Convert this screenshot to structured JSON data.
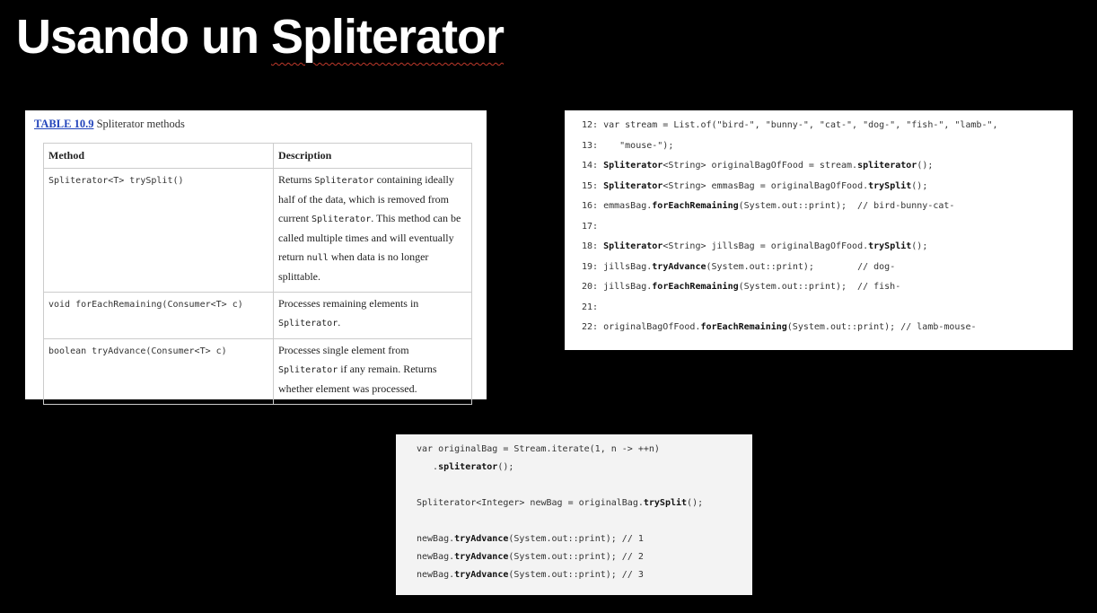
{
  "slide": {
    "title_pre": "Usando un ",
    "title_word": "Spliterator"
  },
  "table": {
    "caption_num": "TABLE 10.9",
    "caption_text": " Spliterator methods",
    "headers": [
      "Method",
      "Description"
    ],
    "rows": [
      {
        "method": "Spliterator<T> trySplit()",
        "desc_parts": [
          [
            "Returns ",
            false
          ],
          [
            "Spliterator",
            true
          ],
          [
            " containing ideally half of the data, which is removed from current ",
            false
          ],
          [
            "Spliterator",
            true
          ],
          [
            ". This method can be called multiple times and will eventually return ",
            false
          ],
          [
            "null",
            true
          ],
          [
            " when data is no longer splittable.",
            false
          ]
        ]
      },
      {
        "method": "void forEachRemaining(Consumer<T> c)",
        "desc_parts": [
          [
            "Processes remaining elements in ",
            false
          ],
          [
            "Spliterator",
            true
          ],
          [
            ".",
            false
          ]
        ]
      },
      {
        "method": "boolean tryAdvance(Consumer<T> c)",
        "desc_parts": [
          [
            "Processes single element from ",
            false
          ],
          [
            "Spliterator",
            true
          ],
          [
            " if any remain. Returns whether element was processed.",
            false
          ]
        ]
      }
    ]
  },
  "code_right": [
    [
      [
        "12: var stream = List.of(\"bird-\", \"bunny-\", \"cat-\", \"dog-\", \"fish-\", \"lamb-\",",
        false
      ]
    ],
    [
      [
        "13:    \"mouse-\");",
        false
      ]
    ],
    [
      [
        "14: ",
        false
      ],
      [
        "Spliterator",
        true
      ],
      [
        "<String> originalBagOfFood = stream.",
        false
      ],
      [
        "spliterator",
        true
      ],
      [
        "();",
        false
      ]
    ],
    [
      [
        "15: ",
        false
      ],
      [
        "Spliterator",
        true
      ],
      [
        "<String> emmasBag = originalBagOfFood.",
        false
      ],
      [
        "trySplit",
        true
      ],
      [
        "();",
        false
      ]
    ],
    [
      [
        "16: emmasBag.",
        false
      ],
      [
        "forEachRemaining",
        true
      ],
      [
        "(System.out::print);  // bird-bunny-cat-",
        false
      ]
    ],
    [
      [
        "17:",
        false
      ]
    ],
    [
      [
        "18: ",
        false
      ],
      [
        "Spliterator",
        true
      ],
      [
        "<String> jillsBag = originalBagOfFood.",
        false
      ],
      [
        "trySplit",
        true
      ],
      [
        "();",
        false
      ]
    ],
    [
      [
        "19: jillsBag.",
        false
      ],
      [
        "tryAdvance",
        true
      ],
      [
        "(System.out::print);        // dog-",
        false
      ]
    ],
    [
      [
        "20: jillsBag.",
        false
      ],
      [
        "forEachRemaining",
        true
      ],
      [
        "(System.out::print);  // fish-",
        false
      ]
    ],
    [
      [
        "21:",
        false
      ]
    ],
    [
      [
        "22: originalBagOfFood.",
        false
      ],
      [
        "forEachRemaining",
        true
      ],
      [
        "(System.out::print); // lamb-mouse-",
        false
      ]
    ]
  ],
  "code_bottom": [
    [
      [
        "var originalBag = Stream.iterate(1, n -> ++n)",
        false
      ]
    ],
    [
      [
        "   .",
        false
      ],
      [
        "spliterator",
        true
      ],
      [
        "();",
        false
      ]
    ],
    [
      [
        "",
        false
      ]
    ],
    [
      [
        "Spliterator<Integer> newBag = originalBag.",
        false
      ],
      [
        "trySplit",
        true
      ],
      [
        "();",
        false
      ]
    ],
    [
      [
        "",
        false
      ]
    ],
    [
      [
        "newBag.",
        false
      ],
      [
        "tryAdvance",
        true
      ],
      [
        "(System.out::print); // 1",
        false
      ]
    ],
    [
      [
        "newBag.",
        false
      ],
      [
        "tryAdvance",
        true
      ],
      [
        "(System.out::print); // 2",
        false
      ]
    ],
    [
      [
        "newBag.",
        false
      ],
      [
        "tryAdvance",
        true
      ],
      [
        "(System.out::print); // 3",
        false
      ]
    ]
  ]
}
